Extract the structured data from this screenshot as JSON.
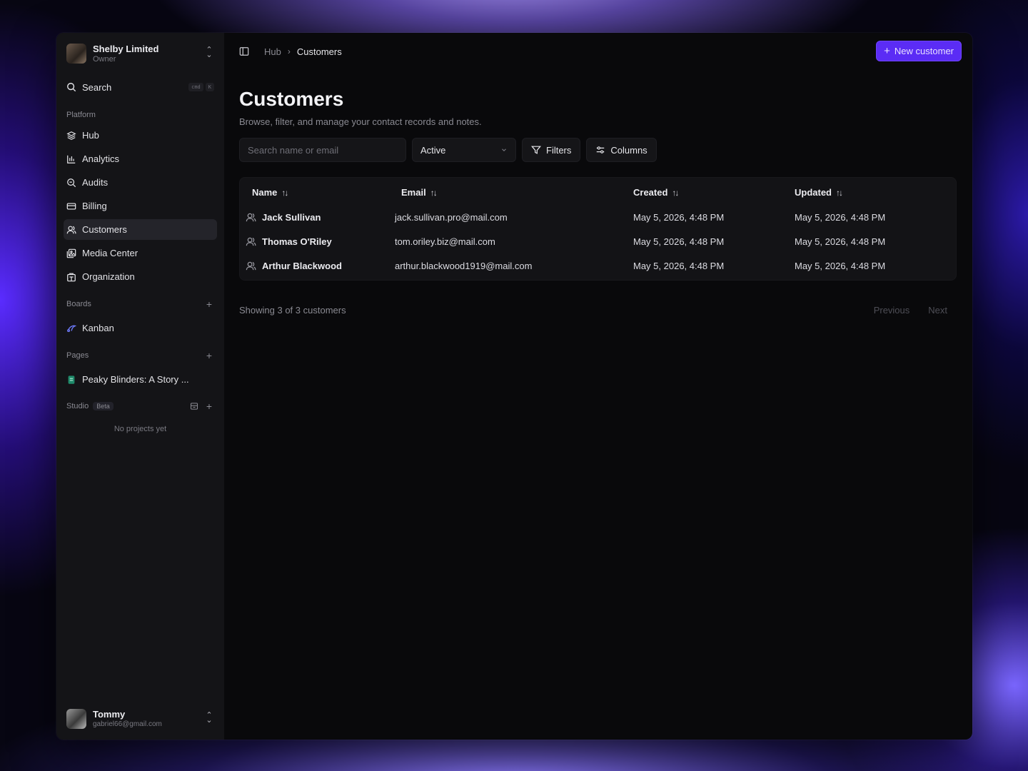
{
  "org": {
    "name": "Shelby Limited",
    "role": "Owner"
  },
  "sidebar": {
    "search": {
      "label": "Search",
      "kbd1": "cmd",
      "kbd2": "K"
    },
    "platform_label": "Platform",
    "items": [
      {
        "label": "Hub",
        "icon": "layers-icon"
      },
      {
        "label": "Analytics",
        "icon": "bar-chart-icon"
      },
      {
        "label": "Audits",
        "icon": "search-zoom-icon"
      },
      {
        "label": "Billing",
        "icon": "credit-card-icon"
      },
      {
        "label": "Customers",
        "icon": "users-icon",
        "active": true
      },
      {
        "label": "Media Center",
        "icon": "media-icon"
      },
      {
        "label": "Organization",
        "icon": "building-icon"
      }
    ],
    "boards_label": "Boards",
    "boards": [
      {
        "label": "Kanban",
        "icon": "kanban-icon"
      }
    ],
    "pages_label": "Pages",
    "pages": [
      {
        "label": "Peaky Blinders: A Story ...",
        "icon": "page-icon"
      }
    ],
    "studio_label": "Studio",
    "studio_badge": "Beta",
    "studio_empty": "No projects yet"
  },
  "user": {
    "name": "Tommy",
    "email": "gabriel66@gmail.com"
  },
  "breadcrumb": {
    "root": "Hub",
    "sep": "›",
    "current": "Customers"
  },
  "header": {
    "new_button": "New customer",
    "new_icon": "+"
  },
  "page": {
    "title": "Customers",
    "subtitle": "Browse, filter, and manage your contact records and notes."
  },
  "toolbar": {
    "search_placeholder": "Search name or email",
    "status_value": "Active",
    "filters_label": "Filters",
    "columns_label": "Columns"
  },
  "table": {
    "columns": [
      "Name",
      "Email",
      "Created",
      "Updated"
    ],
    "sort_glyph": "↑↓",
    "rows": [
      {
        "name": "Jack Sullivan",
        "email": "jack.sullivan.pro@mail.com",
        "created": "May 5, 2026, 4:48 PM",
        "updated": "May 5, 2026, 4:48 PM"
      },
      {
        "name": "Thomas O'Riley",
        "email": "tom.oriley.biz@mail.com",
        "created": "May 5, 2026, 4:48 PM",
        "updated": "May 5, 2026, 4:48 PM"
      },
      {
        "name": "Arthur Blackwood",
        "email": "arthur.blackwood1919@mail.com",
        "created": "May 5, 2026, 4:48 PM",
        "updated": "May 5, 2026, 4:48 PM"
      }
    ]
  },
  "pagination": {
    "summary": "Showing 3 of 3 customers",
    "prev": "Previous",
    "next": "Next"
  },
  "colors": {
    "accent": "#5b2cf5",
    "background": "#09090b",
    "sidebar": "#141417"
  }
}
